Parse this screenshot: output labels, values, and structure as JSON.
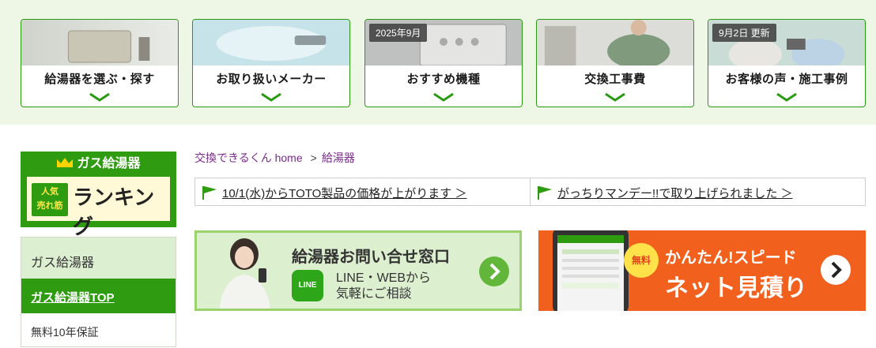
{
  "categories": [
    {
      "label": "給湯器を選ぶ・探す",
      "badge": ""
    },
    {
      "label": "お取り扱いメーカー",
      "badge": ""
    },
    {
      "label": "おすすめ機種",
      "badge": "2025年9月"
    },
    {
      "label": "交換工事費",
      "badge": ""
    },
    {
      "label": "お客様の声・施工事例",
      "badge": "9月2日 更新"
    }
  ],
  "ranking": {
    "title": "ガス給湯器",
    "tag_line1": "人気",
    "tag_line2": "売れ筋",
    "word": "ランキング"
  },
  "sidebar": {
    "heading": "ガス給湯器",
    "active_item": "ガス給湯器TOP",
    "item_1": "無料10年保証"
  },
  "breadcrumb": {
    "home": "交換できるくん home",
    "separator": ">",
    "current": "給湯器"
  },
  "notices": [
    {
      "text": "10/1(水)からTOTO製品の価格が上がります ＞"
    },
    {
      "text": "がっちりマンデー!!で取り上げられました ＞"
    }
  ],
  "banners": {
    "contact": {
      "title": "給湯器お問い合せ窓口",
      "line_badge": "LINE",
      "line1": "LINE・WEBから",
      "line2": "気軽にご相談"
    },
    "estimate": {
      "free": "無料",
      "line1": "かんたん!スピード",
      "line2": "ネット見積り"
    }
  },
  "colors": {
    "brand_green": "#2f9b11",
    "orange": "#f2601e"
  }
}
